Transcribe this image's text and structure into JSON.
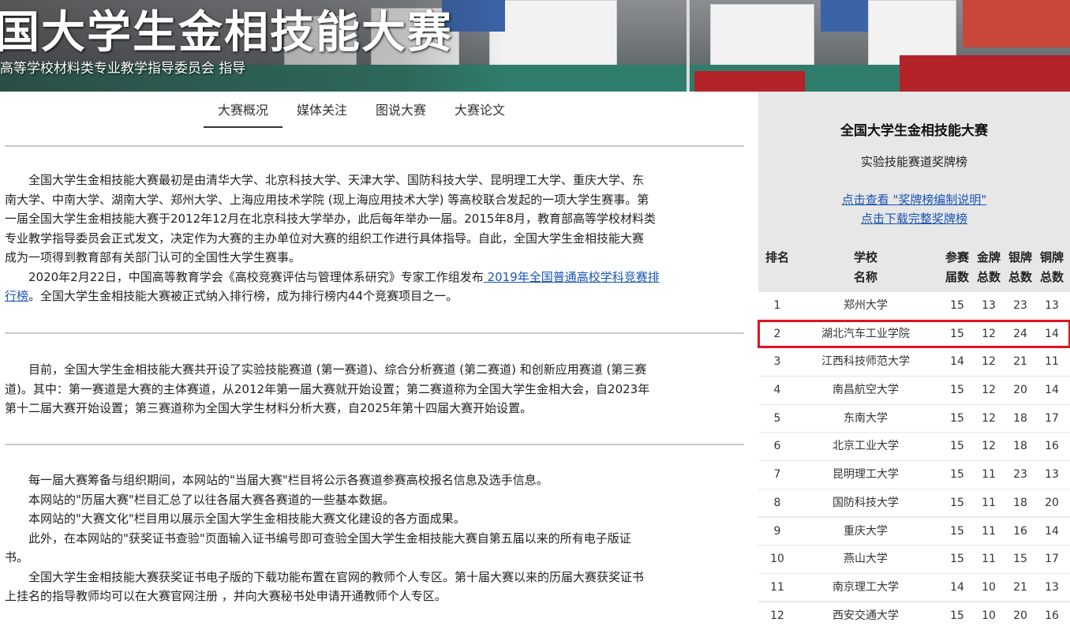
{
  "banner": {
    "title": "国大学生金相技能大赛",
    "subtitle": "高等学校材料类专业教学指导委员会 指导"
  },
  "tabs": [
    {
      "label": "大赛概况",
      "active": true
    },
    {
      "label": "媒体关注",
      "active": false
    },
    {
      "label": "图说大赛",
      "active": false
    },
    {
      "label": "大赛论文",
      "active": false
    }
  ],
  "section1": {
    "lines": [
      "全国大学生金相技能大赛最初是由清华大学、北京科技大学、天津大学、国防科技大学、昆明理工大学、重庆大学、东",
      "南大学、中南大学、湖南大学、郑州大学、上海应用技术学院 (现上海应用技术大学) 等高校联合发起的一项大学生赛事。第",
      "一届全国大学生金相技能大赛于2012年12月在北京科技大学举办，此后每年举办一届。2015年8月，教育部高等学校材料类",
      "专业教学指导委员会正式发文，决定作为大赛的主办单位对大赛的组织工作进行具体指导。自此，全国大学生金相技能大赛",
      "成为一项得到教育部有关部门认可的全国性大学生赛事。"
    ],
    "para2_pre": "2020年2月22日，中国高等教育学会《高校竞赛评估与管理体系研究》专家工作组发布",
    "para2_link_a": " 2019年全国普通高校学科竞赛排",
    "para2_link_b": "行榜",
    "para2_post": "。全国大学生金相技能大赛被正式纳入排行榜，成为排行榜内44个竞赛项目之一。"
  },
  "section2": {
    "lines": [
      "目前，全国大学生金相技能大赛共开设了实验技能赛道 (第一赛道)、综合分析赛道 (第二赛道) 和创新应用赛道 (第三赛",
      "道)。其中：第一赛道是大赛的主体赛道，从2012年第一届大赛就开始设置；第二赛道称为全国大学生金相大会，自2023年",
      "第十二届大赛开始设置；第三赛道称为全国大学生材料分析大赛，自2025年第十四届大赛开始设置。"
    ]
  },
  "section3": {
    "p1": "每一届大赛筹备与组织期间，本网站的\"当届大赛\"栏目将公示各赛道参赛高校报名信息及选手信息。",
    "p2": "本网站的\"历届大赛\"栏目汇总了以往各届大赛各赛道的一些基本数据。",
    "p3": "本网站的\"大赛文化\"栏目用以展示全国大学生金相技能大赛文化建设的各方面成果。",
    "p4a": "此外，在本网站的\"获奖证书查验\"页面输入证书编号即可查验全国大学生金相技能大赛自第五届以来的所有电子版证",
    "p4b": "书。",
    "p5a": "全国大学生金相技能大赛获奖证书电子版的下载功能布置在官网的教师个人专区。第十届大赛以来的历届大赛获奖证书",
    "p5b": "上挂名的指导教师均可以在大赛官网注册 ，并向大赛秘书处申请开通教师个人专区。"
  },
  "sidebar": {
    "title": "全国大学生金相技能大赛",
    "subtitle": "实验技能赛道奖牌榜",
    "link1": "点击查看 \"奖牌榜编制说明\"",
    "link2": "点击下载完整奖牌榜",
    "headers": {
      "rank": "排名",
      "school_1": "学校",
      "school_2": "名称",
      "sessions_1": "参赛",
      "sessions_2": "届数",
      "gold_1": "金牌",
      "gold_2": "总数",
      "silver_1": "银牌",
      "silver_2": "总数",
      "bronze_1": "铜牌",
      "bronze_2": "总数"
    },
    "rows": [
      {
        "rank": "1",
        "school": "郑州大学",
        "sessions": "15",
        "gold": "13",
        "silver": "23",
        "bronze": "13",
        "highlight": false
      },
      {
        "rank": "2",
        "school": "湖北汽车工业学院",
        "sessions": "15",
        "gold": "12",
        "silver": "24",
        "bronze": "14",
        "highlight": true
      },
      {
        "rank": "3",
        "school": "江西科技师范大学",
        "sessions": "14",
        "gold": "12",
        "silver": "21",
        "bronze": "11",
        "highlight": false
      },
      {
        "rank": "4",
        "school": "南昌航空大学",
        "sessions": "15",
        "gold": "12",
        "silver": "20",
        "bronze": "14",
        "highlight": false
      },
      {
        "rank": "5",
        "school": "东南大学",
        "sessions": "15",
        "gold": "12",
        "silver": "18",
        "bronze": "17",
        "highlight": false
      },
      {
        "rank": "6",
        "school": "北京工业大学",
        "sessions": "15",
        "gold": "12",
        "silver": "18",
        "bronze": "16",
        "highlight": false
      },
      {
        "rank": "7",
        "school": "昆明理工大学",
        "sessions": "15",
        "gold": "11",
        "silver": "23",
        "bronze": "13",
        "highlight": false
      },
      {
        "rank": "8",
        "school": "国防科技大学",
        "sessions": "15",
        "gold": "11",
        "silver": "18",
        "bronze": "20",
        "highlight": false
      },
      {
        "rank": "9",
        "school": "重庆大学",
        "sessions": "15",
        "gold": "11",
        "silver": "16",
        "bronze": "14",
        "highlight": false
      },
      {
        "rank": "10",
        "school": "燕山大学",
        "sessions": "15",
        "gold": "11",
        "silver": "15",
        "bronze": "17",
        "highlight": false
      },
      {
        "rank": "11",
        "school": "南京理工大学",
        "sessions": "14",
        "gold": "10",
        "silver": "21",
        "bronze": "13",
        "highlight": false
      },
      {
        "rank": "12",
        "school": "西安交通大学",
        "sessions": "15",
        "gold": "10",
        "silver": "20",
        "bronze": "16",
        "highlight": false
      }
    ]
  },
  "colors": {
    "link": "#1a55b5",
    "highlight_border": "#e0141e",
    "sidebar_bg": "#e7e7e7"
  }
}
